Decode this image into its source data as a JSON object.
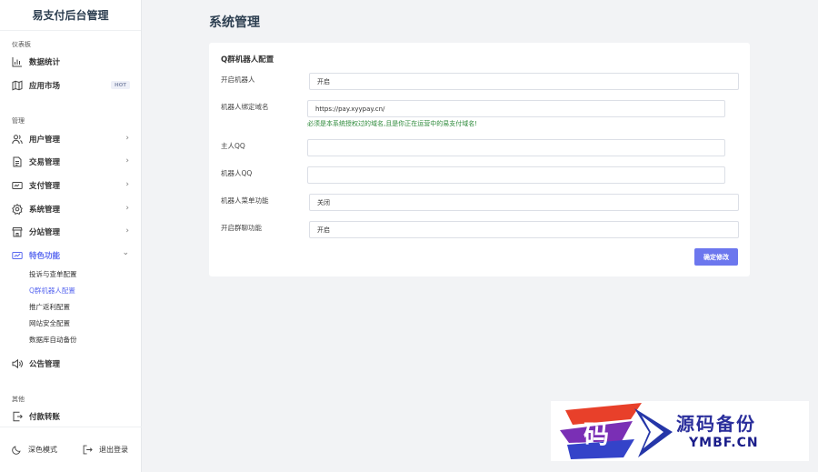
{
  "app": {
    "title": "易支付后台管理"
  },
  "sidebar": {
    "sections": [
      {
        "label": "仪表板"
      },
      {
        "label": "管理"
      },
      {
        "label": "其他"
      }
    ],
    "items": [
      {
        "label": "数据统计",
        "icon": "bar-chart-icon"
      },
      {
        "label": "应用市场",
        "icon": "map-icon",
        "badge": "HOT"
      },
      {
        "label": "用户管理",
        "icon": "users-icon",
        "chevron": "›"
      },
      {
        "label": "交易管理",
        "icon": "document-icon",
        "chevron": "›"
      },
      {
        "label": "支付管理",
        "icon": "credit-card-icon",
        "chevron": "›"
      },
      {
        "label": "系统管理",
        "icon": "gear-icon",
        "chevron": "›"
      },
      {
        "label": "分站管理",
        "icon": "storefront-icon",
        "chevron": "›"
      },
      {
        "label": "特色功能",
        "icon": "trend-icon",
        "chevron": "⌄",
        "expanded": true
      },
      {
        "label": "公告管理",
        "icon": "speaker-icon"
      },
      {
        "label": "付款转账",
        "icon": "transfer-icon"
      }
    ],
    "subitems": [
      {
        "label": "投诉与查单配置"
      },
      {
        "label": "Q群机器人配置",
        "active": true
      },
      {
        "label": "推广返利配置"
      },
      {
        "label": "网站安全配置"
      },
      {
        "label": "数据库自动备份"
      }
    ],
    "footer": {
      "dark_mode": "深色模式",
      "logout": "退出登录"
    }
  },
  "main": {
    "page_title": "系统管理",
    "card_title": "Q群机器人配置",
    "fields": [
      {
        "label": "开启机器人",
        "value": "开启",
        "type": "select"
      },
      {
        "label": "机器人绑定域名",
        "value": "https://pay.xyypay.cn/",
        "type": "input"
      },
      {
        "label": "主人QQ",
        "value": "",
        "type": "input"
      },
      {
        "label": "机器人QQ",
        "value": "",
        "type": "input"
      },
      {
        "label": "机器人菜单功能",
        "value": "关闭",
        "type": "select"
      },
      {
        "label": "开启群聊功能",
        "value": "开启",
        "type": "select"
      }
    ],
    "domain_hint": "必须是本系统授权过的域名,且是你正在运营中的易支付域名!",
    "submit_label": "确定修改"
  },
  "watermark": {
    "glyph": "码",
    "text_cn": "源码备份",
    "text_en": "YMBF.CN"
  },
  "colors": {
    "accent": "#5b6af0",
    "button": "#6c77ee",
    "hint": "#2d8a3a",
    "background": "#f2f3f5"
  }
}
